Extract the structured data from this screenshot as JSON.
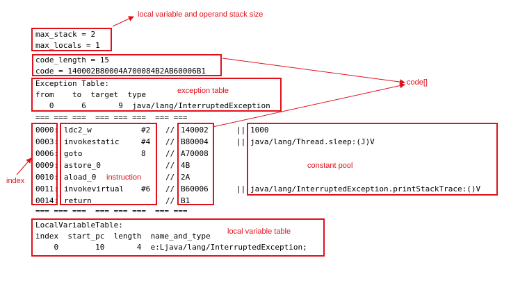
{
  "colors": {
    "annotation": "#e0101a",
    "text": "#000000",
    "background": "#ffffff"
  },
  "annotations": {
    "stack_size": "local variable and operand stack size",
    "code_array": "code[]",
    "exception_table": "exception table",
    "index": "index",
    "instruction": "instruction",
    "constant_pool": "constant pool",
    "local_variable_table": "local variable table"
  },
  "header": {
    "max_stack": "max_stack = 2",
    "max_locals": "max_locals = 1",
    "code_length": "code_length = 15",
    "code": "code = 140002B80004A700084B2AB60006B1"
  },
  "exception_table": {
    "title": "Exception Table:",
    "columns": "from    to  target  type",
    "row": "   0      6       9  java/lang/InterruptedException"
  },
  "separator": "=== === ===  === === ===  === ===",
  "instructions": [
    {
      "index": "0000:",
      "op": "ldc2_w",
      "arg": "#2",
      "slashes": "//",
      "hex": "140002",
      "sep": "||",
      "cp": "1000"
    },
    {
      "index": "0003:",
      "op": "invokestatic",
      "arg": "#4",
      "slashes": "//",
      "hex": "B80004",
      "sep": "||",
      "cp": "java/lang/Thread.sleep:(J)V"
    },
    {
      "index": "0006:",
      "op": "goto",
      "arg": "8",
      "slashes": "//",
      "hex": "A70008",
      "sep": "",
      "cp": ""
    },
    {
      "index": "0009:",
      "op": "astore_0",
      "arg": "",
      "slashes": "//",
      "hex": "4B",
      "sep": "",
      "cp": ""
    },
    {
      "index": "0010:",
      "op": "aload_0",
      "arg": "",
      "slashes": "//",
      "hex": "2A",
      "sep": "",
      "cp": ""
    },
    {
      "index": "0011:",
      "op": "invokevirtual",
      "arg": "#6",
      "slashes": "//",
      "hex": "B60006",
      "sep": "||",
      "cp": "java/lang/InterruptedException.printStackTrace:()V"
    },
    {
      "index": "0014:",
      "op": "return",
      "arg": "",
      "slashes": "//",
      "hex": "B1",
      "sep": "",
      "cp": ""
    }
  ],
  "local_variable_table": {
    "title": "LocalVariableTable:",
    "columns": "index  start_pc  length  name_and_type",
    "row": "    0        10       4  e:Ljava/lang/InterruptedException;"
  }
}
